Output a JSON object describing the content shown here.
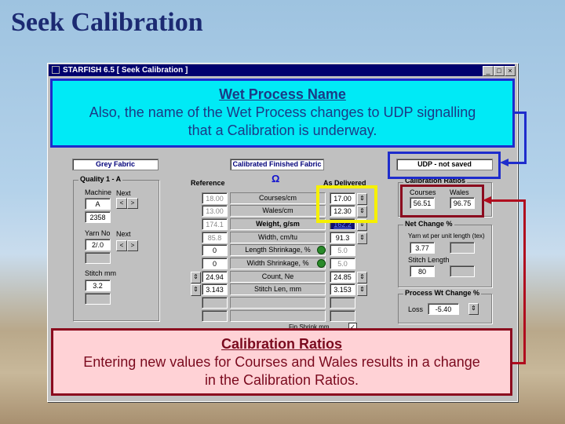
{
  "slide_title": "Seek Calibration",
  "window": {
    "title": "STARFISH 6.5    [ Seek Calibration ]",
    "controls": [
      "_",
      "□",
      "×"
    ]
  },
  "headers": {
    "grey_fabric": "Grey Fabric",
    "calibrated_finished_fabric": "Calibrated Finished Fabric",
    "wet_process": "UDP - not saved"
  },
  "quality": {
    "group_title": "Quality 1 - A",
    "machine_label": "Machine",
    "machine_value": "A",
    "machine_code": "2358",
    "next_label": "Next",
    "yarn_label": "Yarn No",
    "yarn_value": "2/.0",
    "stitch_label": "Stitch mm",
    "stitch_value": "3.2"
  },
  "table": {
    "reference_header": "Reference",
    "delivered_header": "As Delivered",
    "rows": [
      {
        "reference": "18.00",
        "label": "Courses/cm",
        "delivered": "17.00"
      },
      {
        "reference": "13.00",
        "label": "Wales/cm",
        "delivered": "12.30"
      },
      {
        "reference": "174.1",
        "label": "Weight, g/sm",
        "delivered": "162.2"
      },
      {
        "reference": "85.8",
        "label": "Width, cm/tu",
        "delivered": "91.3"
      },
      {
        "reference": "0",
        "label": "Length Shrinkage, %",
        "delivered": "5.0"
      },
      {
        "reference": "0",
        "label": "Width Shrinkage, %",
        "delivered": "5.0"
      },
      {
        "reference": "24.94",
        "label": "Count, Ne",
        "delivered": "24.85"
      },
      {
        "reference": "3.143",
        "label": "Stitch Len, mm",
        "delivered": "3.153"
      }
    ],
    "fin_shrink_label": "Fin Shrink mm"
  },
  "calibration_ratios": {
    "title": "Calibration Ratios",
    "courses_label": "Courses",
    "courses_value": "56.51",
    "wales_label": "Wales",
    "wales_value": "96.75"
  },
  "net_change": {
    "title": "Net Change %",
    "yarn_label": "Yarn wt per unit length (tex)",
    "yarn_value": "3.77",
    "stitch_label": "Stitch Length",
    "stitch_value": "80"
  },
  "process_wt": {
    "title": "Process Wt Change %",
    "loss_label": "Loss",
    "loss_value": "-5.40"
  },
  "callouts": {
    "wet_process_title": "Wet Process Name",
    "wet_process_text_1": "Also, the name of the Wet Process changes to UDP signalling",
    "wet_process_text_2": "that a Calibration is underway.",
    "ratios_title": "Calibration Ratios",
    "ratios_text_1": "Entering new values for Courses and Wales results in a change",
    "ratios_text_2": "in the Calibration Ratios."
  },
  "colors": {
    "cyan_callout": "#00eaf6",
    "blue_border": "#1e2ccc",
    "pink_callout": "#ffd2d6",
    "red_border": "#8b0a1e",
    "yellow_highlight": "#f6f000"
  }
}
